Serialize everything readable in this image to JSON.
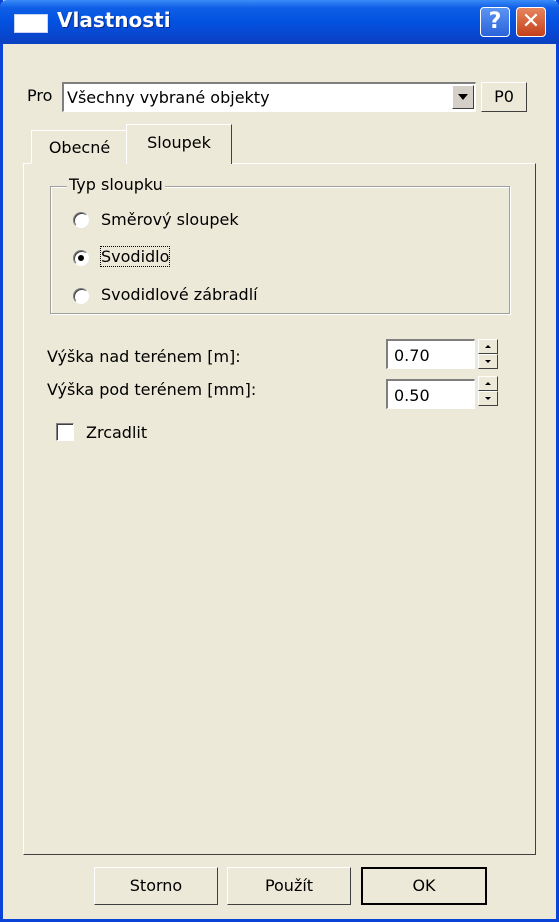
{
  "window": {
    "title": "Vlastnosti",
    "help": "?",
    "close": "✕"
  },
  "pro": {
    "label": "Pro",
    "value": "Všechny vybrané objekty",
    "po_label": "P0"
  },
  "tabs": [
    {
      "label": "Obecné"
    },
    {
      "label": "Sloupek"
    }
  ],
  "group": {
    "title": "Typ sloupku",
    "options": [
      {
        "label": "Směrový sloupek",
        "selected": false
      },
      {
        "label": "Svodidlo",
        "selected": true
      },
      {
        "label": "Svodidlové zábradlí",
        "selected": false
      }
    ]
  },
  "fields": [
    {
      "label": "Výška nad terénem [m]:",
      "value": "0.70"
    },
    {
      "label": "Výška pod terénem [mm]:",
      "value": "0.50"
    }
  ],
  "mirror": {
    "label": "Zrcadlit",
    "checked": false
  },
  "buttons": {
    "cancel": "Storno",
    "apply": "Použít",
    "ok": "OK"
  }
}
